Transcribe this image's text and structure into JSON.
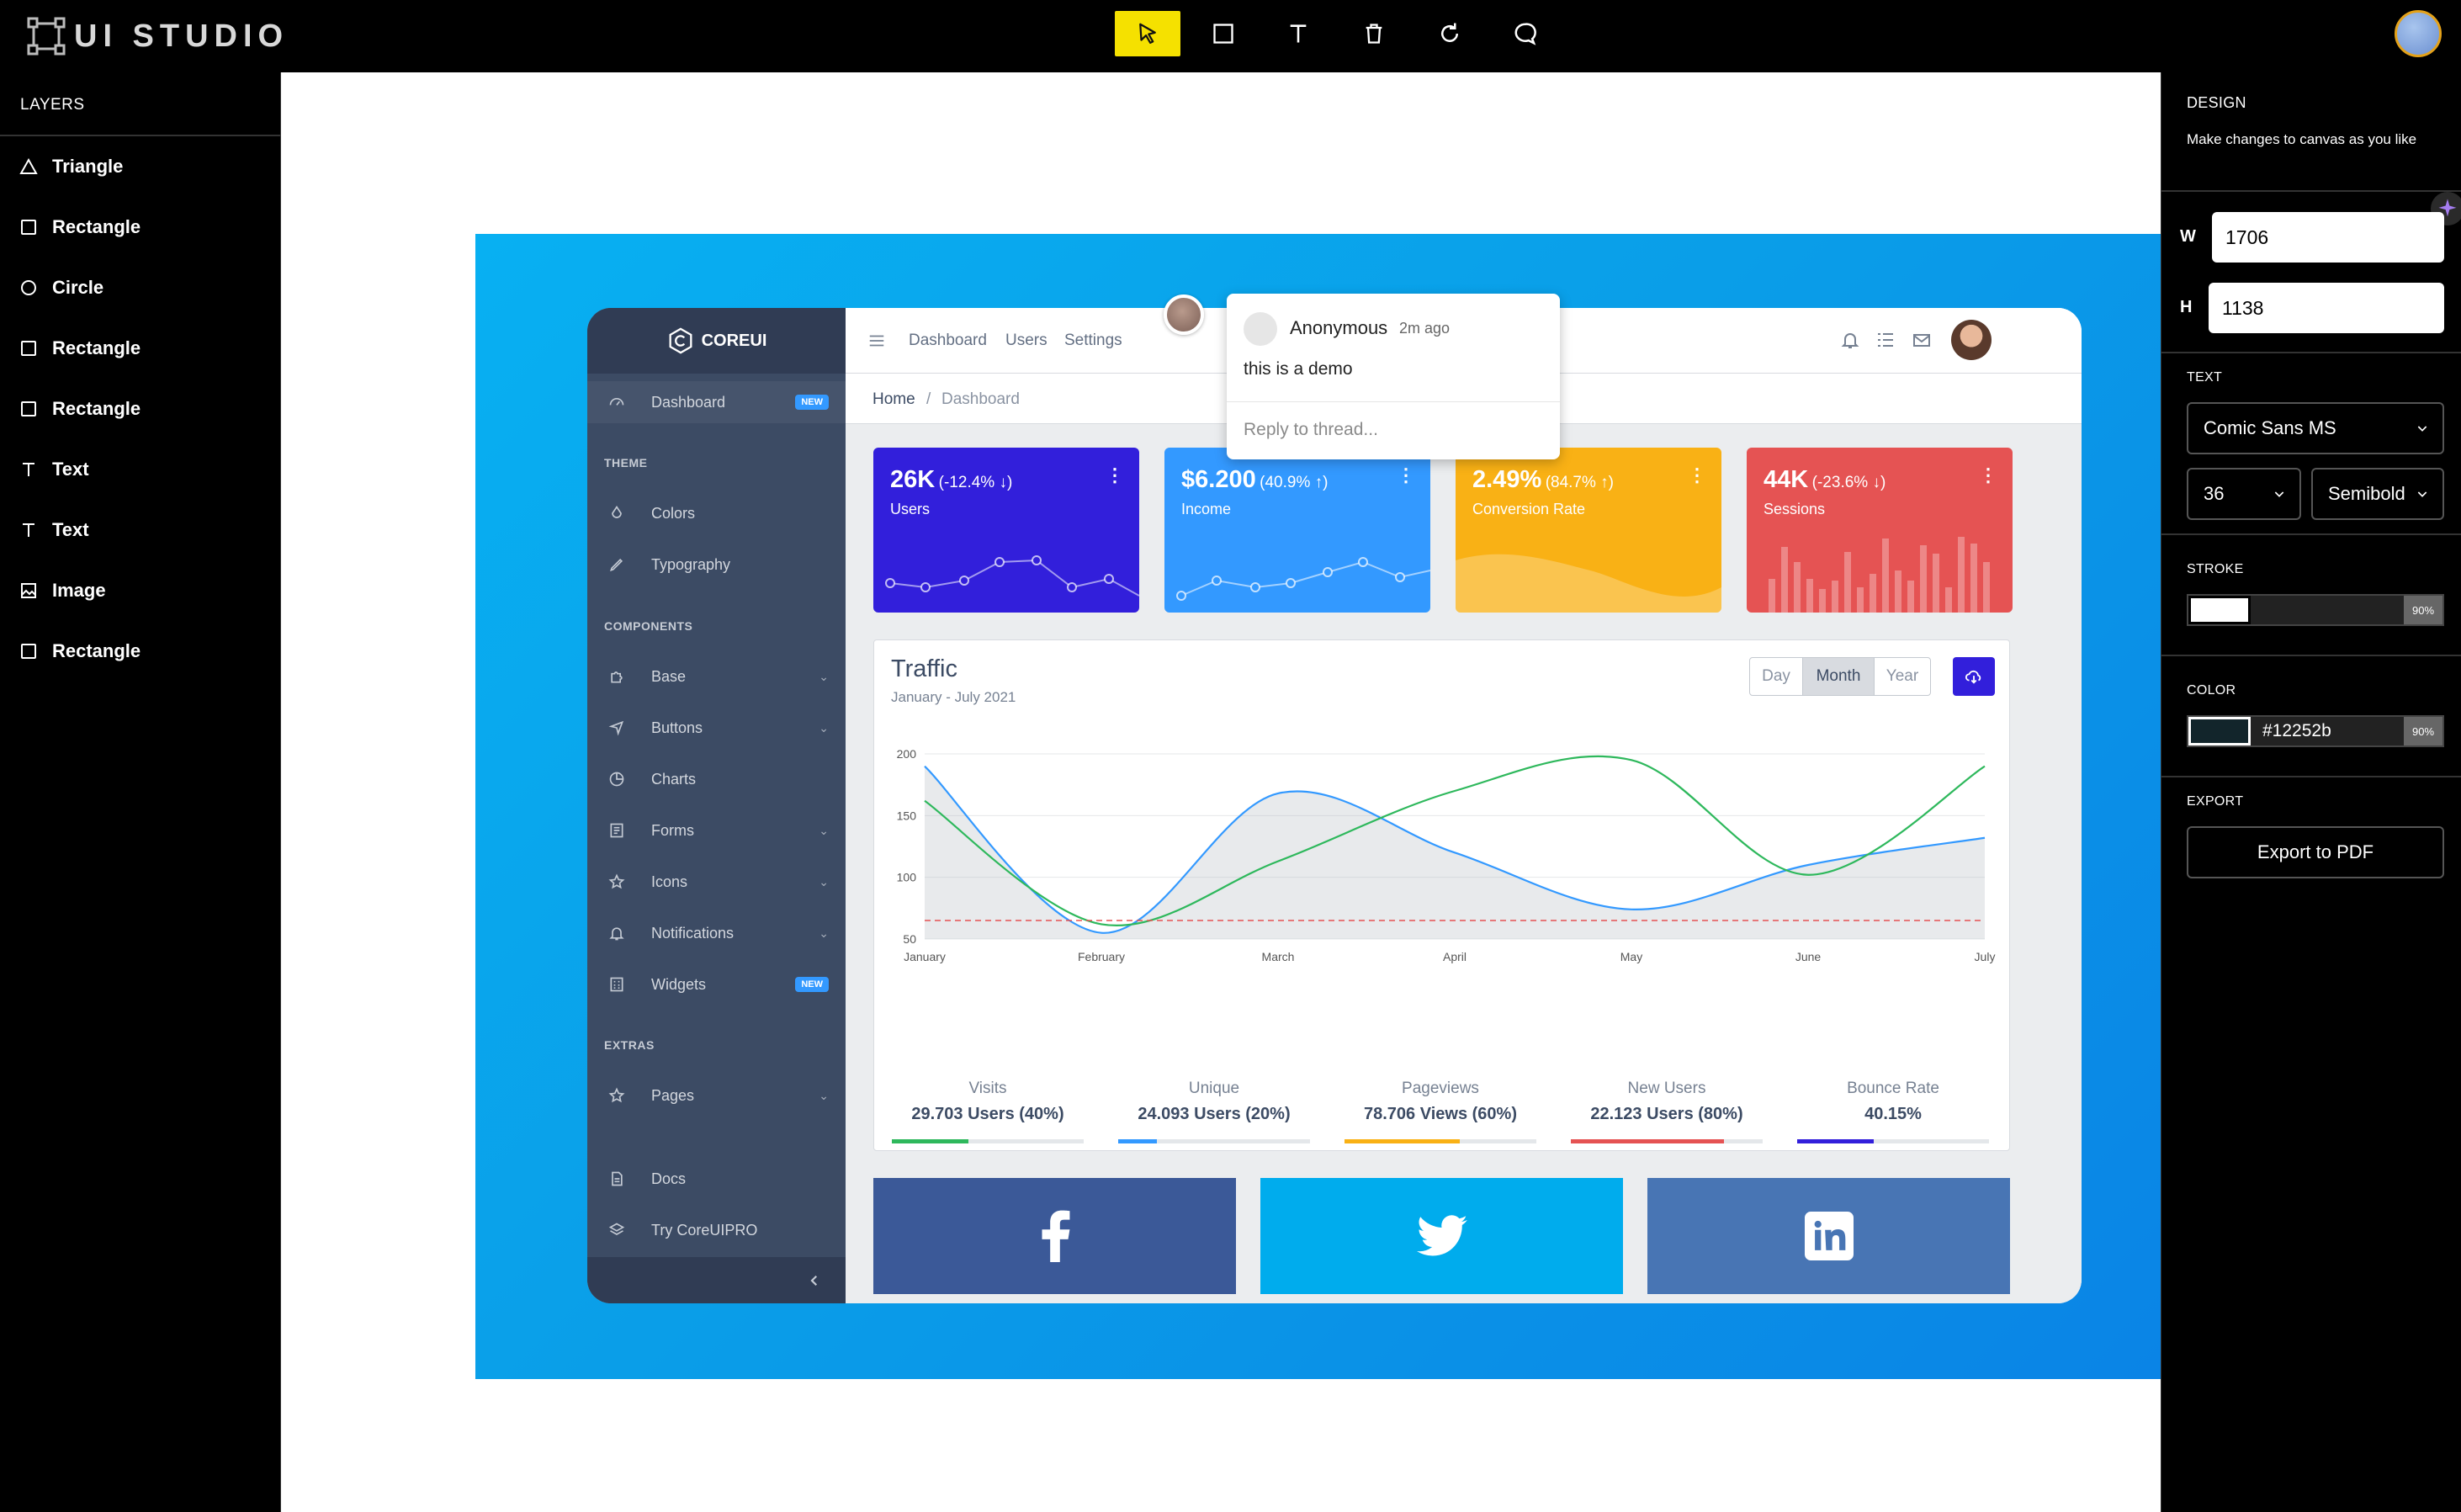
{
  "app": {
    "title": "UI STUDIO"
  },
  "toolbar": {
    "tools": [
      "pointer-tool",
      "rectangle-tool",
      "text-tool",
      "delete-tool",
      "redo-tool",
      "comment-tool"
    ]
  },
  "layers": {
    "heading": "LAYERS",
    "items": [
      {
        "label": "Triangle",
        "icon": "triangle-icon"
      },
      {
        "label": "Rectangle",
        "icon": "square-icon"
      },
      {
        "label": "Circle",
        "icon": "circle-icon"
      },
      {
        "label": "Rectangle",
        "icon": "square-icon"
      },
      {
        "label": "Rectangle",
        "icon": "square-icon"
      },
      {
        "label": "Text",
        "icon": "text-icon"
      },
      {
        "label": "Text",
        "icon": "text-icon"
      },
      {
        "label": "Image",
        "icon": "image-icon"
      },
      {
        "label": "Rectangle",
        "icon": "square-icon"
      }
    ]
  },
  "design": {
    "heading": "DESIGN",
    "hint": "Make changes to canvas as you like",
    "w_label": "W",
    "w_value": "1706",
    "h_label": "H",
    "h_value": "1138",
    "text_heading": "TEXT",
    "font_family": "Comic Sans MS",
    "font_size": "36",
    "font_weight": "Semibold",
    "stroke_heading": "STROKE",
    "stroke_opacity": "90%",
    "color_heading": "COLOR",
    "color_value": "#12252b",
    "color_opacity": "90%",
    "export_heading": "EXPORT",
    "export_button": "Export to PDF"
  },
  "comment": {
    "author": "Anonymous",
    "time": "2m ago",
    "text": "this is a demo",
    "reply_placeholder": "Reply to thread..."
  },
  "dashboard": {
    "brand": "COREUI",
    "nav": {
      "dashboard": "Dashboard",
      "new": "NEW",
      "theme": "THEME",
      "colors": "Colors",
      "typography": "Typography",
      "components": "COMPONENTS",
      "base": "Base",
      "buttons": "Buttons",
      "charts": "Charts",
      "forms": "Forms",
      "icons": "Icons",
      "notifications": "Notifications",
      "widgets": "Widgets",
      "extras": "EXTRAS",
      "pages": "Pages",
      "docs": "Docs",
      "pro": "Try CoreUIPRO"
    },
    "header_links": [
      "Dashboard",
      "Users",
      "Settings"
    ],
    "breadcrumb": {
      "home": "Home",
      "sep": "/",
      "current": "Dashboard"
    },
    "cards": [
      {
        "value": "26K",
        "change": "(-12.4% ↓)",
        "label": "Users",
        "color": "#321fdb"
      },
      {
        "value": "$6.200",
        "change": "(40.9% ↑)",
        "label": "Income",
        "color": "#3399ff"
      },
      {
        "value": "2.49%",
        "change": "(84.7% ↑)",
        "label": "Conversion Rate",
        "color": "#f9b115"
      },
      {
        "value": "44K",
        "change": "(-23.6% ↓)",
        "label": "Sessions",
        "color": "#e55353"
      }
    ],
    "traffic": {
      "title": "Traffic",
      "subtitle": "January - July 2021",
      "periods": [
        "Day",
        "Month",
        "Year"
      ],
      "active_period": "Month"
    },
    "stats": [
      {
        "label": "Visits",
        "value": "29.703 Users (40%)",
        "color": "#2eb85c",
        "pct": 40
      },
      {
        "label": "Unique",
        "value": "24.093 Users (20%)",
        "color": "#39f",
        "pct": 20
      },
      {
        "label": "Pageviews",
        "value": "78.706 Views (60%)",
        "color": "#f9b115",
        "pct": 60
      },
      {
        "label": "New Users",
        "value": "22.123 Users (80%)",
        "color": "#e55353",
        "pct": 80
      },
      {
        "label": "Bounce Rate",
        "value": "40.15%",
        "color": "#321fdb",
        "pct": 40
      }
    ],
    "social": [
      {
        "name": "facebook-icon",
        "color": "#3b5998"
      },
      {
        "name": "twitter-icon",
        "color": "#00aced"
      },
      {
        "name": "linkedin-icon",
        "color": "#4875b4"
      }
    ]
  },
  "chart_data": {
    "type": "line",
    "categories": [
      "January",
      "February",
      "March",
      "April",
      "May",
      "June",
      "July"
    ],
    "y_ticks": [
      "200",
      "150",
      "100",
      "50"
    ],
    "ylim": [
      50,
      200
    ],
    "series": [
      {
        "values": [
          190,
          55,
          168,
          120,
          74,
          110,
          132
        ],
        "color": "#39f",
        "fill": true
      },
      {
        "values": [
          162,
          62,
          113,
          170,
          195,
          102,
          190
        ],
        "color": "#2eb85c"
      },
      {
        "values": [
          65,
          65,
          65,
          65,
          65,
          65,
          65
        ],
        "color": "#e55353",
        "dashed": true
      }
    ]
  }
}
